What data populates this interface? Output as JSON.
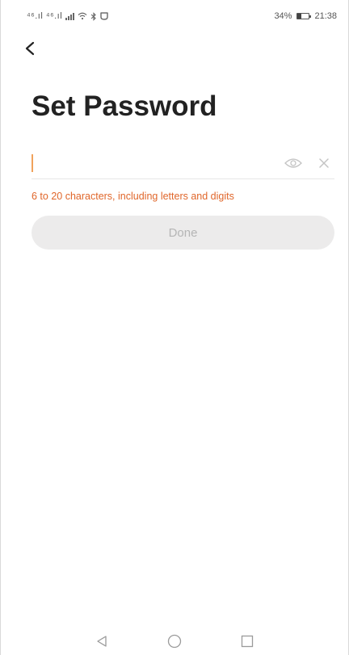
{
  "status_bar": {
    "left_text": "⁴⁶.ıl ⁴⁶.ıl",
    "battery_percent": "34%",
    "battery_level": 0.34,
    "time": "21:38"
  },
  "screen": {
    "title": "Set Password"
  },
  "password_field": {
    "value": "",
    "placeholder": ""
  },
  "hint": "6 to 20 characters, including letters and digits",
  "done_label": "Done",
  "icons": {
    "back": "back-arrow-icon",
    "visibility": "eye-icon",
    "clear": "close-icon",
    "nav_back": "triangle-back-icon",
    "nav_home": "circle-home-icon",
    "nav_recents": "square-recents-icon"
  },
  "colors": {
    "caret": "#f0a25c",
    "hint": "#e0662a",
    "button_bg": "#ecebeb",
    "button_text": "#b5b5b5"
  }
}
